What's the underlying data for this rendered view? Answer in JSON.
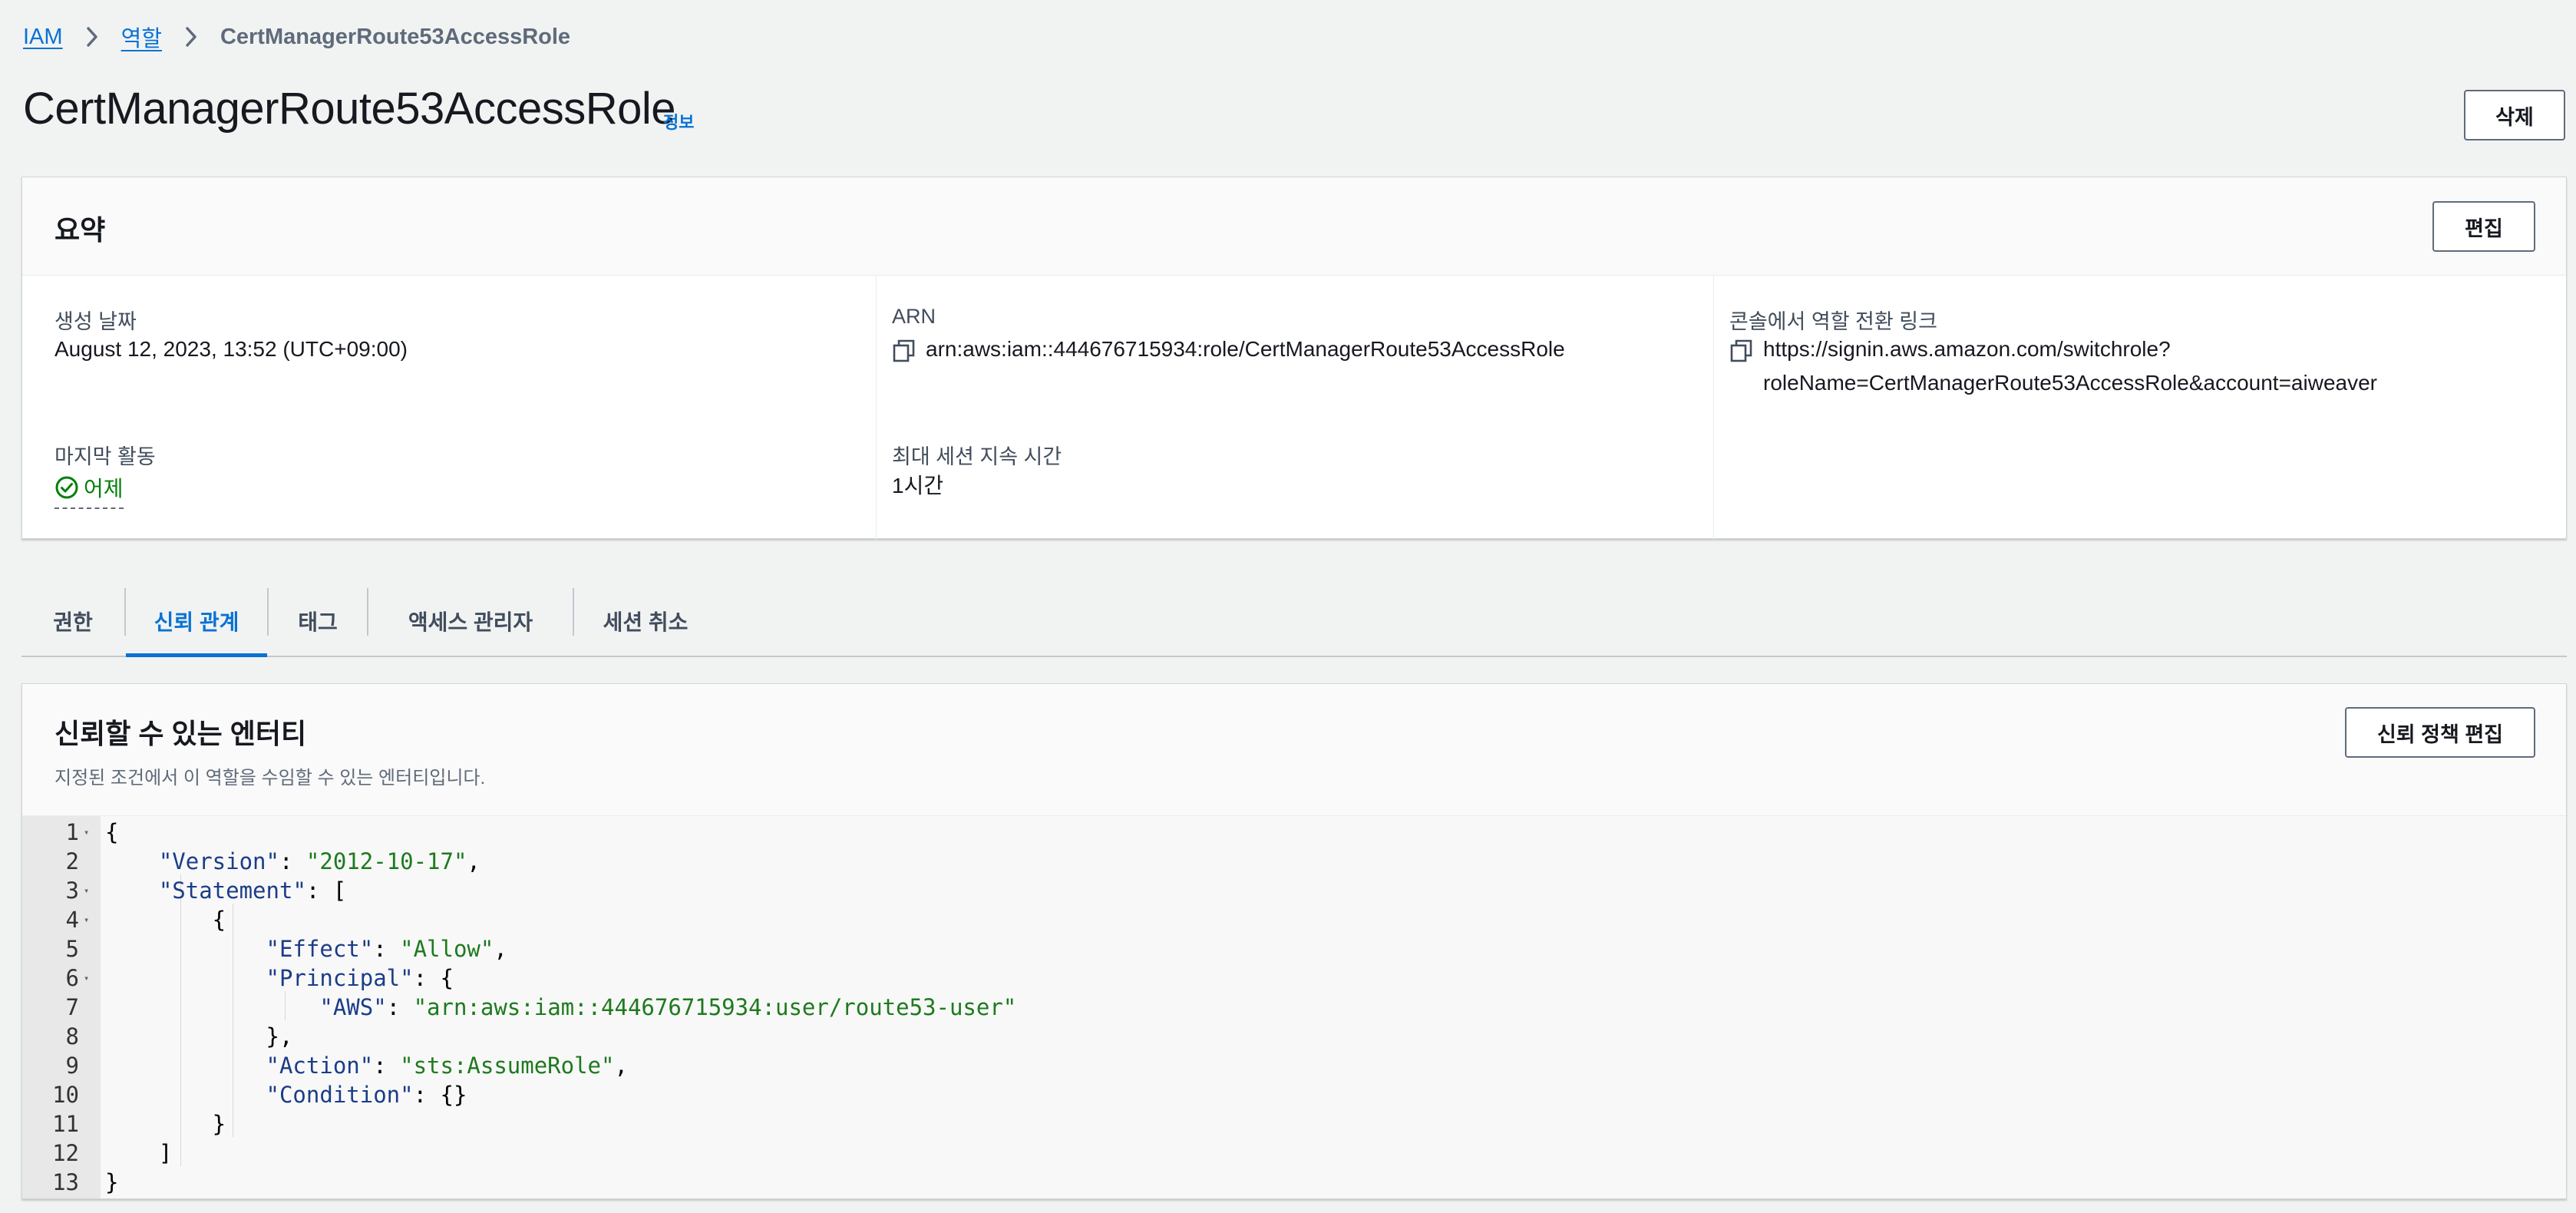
{
  "breadcrumb": {
    "items": [
      {
        "label": "IAM"
      },
      {
        "label": "역할"
      },
      {
        "label": "CertManagerRoute53AccessRole"
      }
    ]
  },
  "header": {
    "title": "CertManagerRoute53AccessRole",
    "info_link": "정보",
    "delete_label": "삭제"
  },
  "summary": {
    "title": "요약",
    "edit_label": "편집",
    "created": {
      "label": "생성 날짜",
      "value": "August 12, 2023, 13:52 (UTC+09:00)"
    },
    "arn": {
      "label": "ARN",
      "value": "arn:aws:iam::444676715934:role/CertManagerRoute53AccessRole"
    },
    "switch_link": {
      "label": "콘솔에서 역할 전환 링크",
      "line1": "https://signin.aws.amazon.com/switchrole?",
      "line2": "roleName=CertManagerRoute53AccessRole&account=aiweaver"
    },
    "last_activity": {
      "label": "마지막 활동",
      "value": "어제"
    },
    "max_session": {
      "label": "최대 세션 지속 시간",
      "value": "1시간"
    }
  },
  "tabs": [
    {
      "label": "권한",
      "active": false
    },
    {
      "label": "신뢰 관계",
      "active": true
    },
    {
      "label": "태그",
      "active": false
    },
    {
      "label": "액세스 관리자",
      "active": false
    },
    {
      "label": "세션 취소",
      "active": false
    }
  ],
  "trusted_entities": {
    "title": "신뢰할 수 있는 엔터티",
    "description": "지정된 조건에서 이 역할을 수임할 수 있는 엔터티입니다.",
    "edit_policy_label": "신뢰 정책 편집",
    "code_lines": [
      {
        "num": "1",
        "foldable": true,
        "text": "{"
      },
      {
        "num": "2",
        "foldable": false,
        "text": "    \"Version\": \"2012-10-17\","
      },
      {
        "num": "3",
        "foldable": true,
        "text": "    \"Statement\": ["
      },
      {
        "num": "4",
        "foldable": true,
        "text": "        {"
      },
      {
        "num": "5",
        "foldable": false,
        "text": "            \"Effect\": \"Allow\","
      },
      {
        "num": "6",
        "foldable": true,
        "text": "            \"Principal\": {"
      },
      {
        "num": "7",
        "foldable": false,
        "text": "                \"AWS\": \"arn:aws:iam::444676715934:user/route53-user\""
      },
      {
        "num": "8",
        "foldable": false,
        "text": "            },"
      },
      {
        "num": "9",
        "foldable": false,
        "text": "            \"Action\": \"sts:AssumeRole\","
      },
      {
        "num": "10",
        "foldable": false,
        "text": "            \"Condition\": {}"
      },
      {
        "num": "11",
        "foldable": false,
        "text": "        }"
      },
      {
        "num": "12",
        "foldable": false,
        "text": "    ]"
      },
      {
        "num": "13",
        "foldable": false,
        "text": "}"
      }
    ]
  },
  "colors": {
    "link": "#0972d3",
    "success": "#037f0c",
    "json_key": "#1b3d88",
    "json_string": "#1e7a1e"
  }
}
